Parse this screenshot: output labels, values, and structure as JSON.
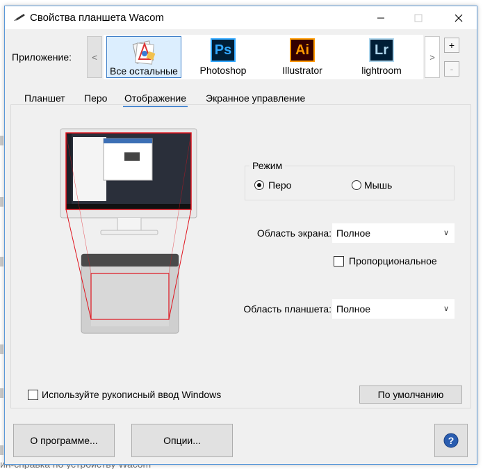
{
  "window": {
    "title": "Свойства планшета Wacom",
    "minimize_icon": "minimize-icon",
    "maximize_icon": "maximize-icon",
    "close_icon": "close-icon"
  },
  "application_bar": {
    "label": "Приложение:",
    "scroll_left": "<",
    "scroll_right": ">",
    "add": "+",
    "remove": "-",
    "apps": [
      {
        "label": "Все остальные",
        "icon": "all-apps-icon",
        "selected": true
      },
      {
        "label": "Photoshop",
        "icon_text": "Ps",
        "color": "#31a8ff",
        "bg": "#001e36"
      },
      {
        "label": "Illustrator",
        "icon_text": "Ai",
        "color": "#ff9a00",
        "bg": "#330000"
      },
      {
        "label": "lightroom",
        "icon_text": "Lr",
        "color": "#add5ec",
        "bg": "#001e36"
      }
    ]
  },
  "tabs": [
    {
      "label": "Планшет"
    },
    {
      "label": "Перо"
    },
    {
      "label": "Отображение",
      "active": true
    },
    {
      "label": "Экранное управление"
    }
  ],
  "mapping": {
    "mode_title": "Режим",
    "mode_pen": "Перо",
    "mode_mouse": "Мышь",
    "mode_selected": "pen",
    "screen_area_label": "Область экрана:",
    "screen_area_value": "Полное",
    "proportional_label": "Пропорциональное",
    "tablet_area_label": "Область планшета:",
    "tablet_area_value": "Полное",
    "windows_ink_label": "Используйте рукописный ввод Windows",
    "default_button": "По умолчанию"
  },
  "footer": {
    "about_button": "О программе...",
    "options_button": "Опции...",
    "help_icon": "help-icon"
  },
  "background": {
    "bottom_text": "ин-справка по устройству Wacom"
  },
  "colors": {
    "accent": "#4c8ad0",
    "mapping_red": "#e0141e",
    "help_blue": "#2a5db0"
  }
}
